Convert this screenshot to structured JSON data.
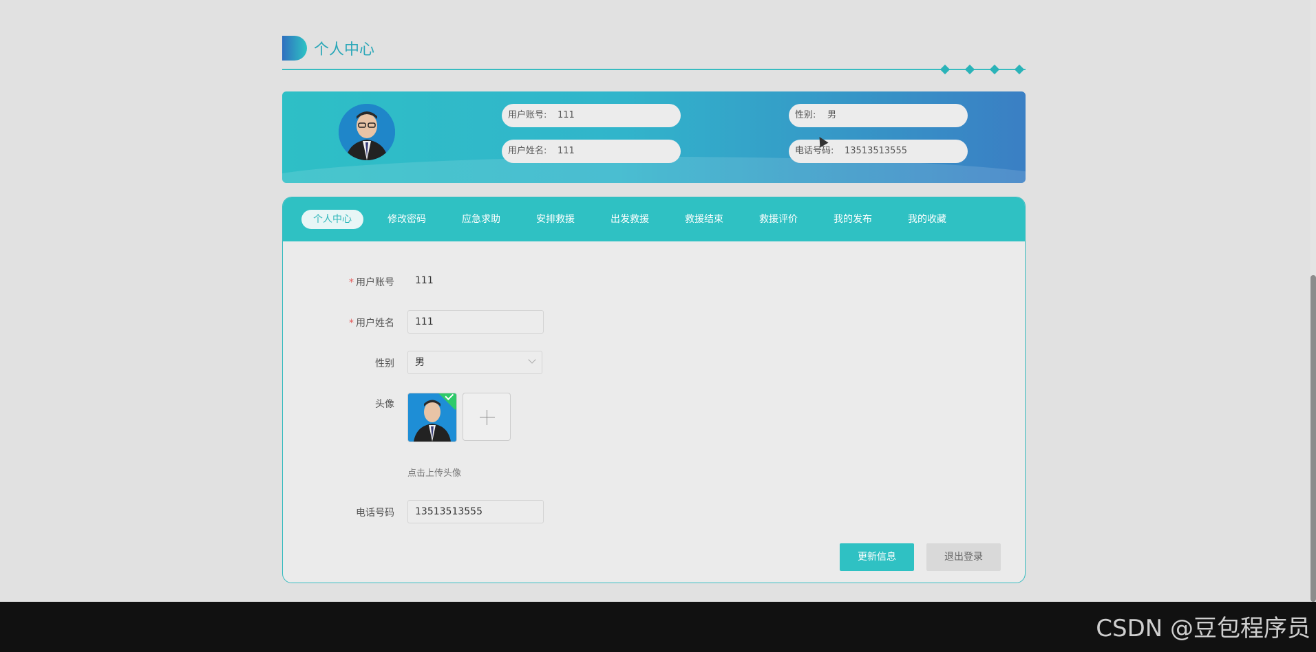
{
  "header": {
    "title": "个人中心"
  },
  "banner": {
    "account_label": "用户账号:",
    "account_value": "111",
    "name_label": "用户姓名:",
    "name_value": "111",
    "gender_label": "性别:",
    "gender_value": "男",
    "phone_label": "电话号码:",
    "phone_value": "13513513555"
  },
  "tabs": [
    {
      "label": "个人中心",
      "active": true
    },
    {
      "label": "修改密码"
    },
    {
      "label": "应急求助"
    },
    {
      "label": "安排救援"
    },
    {
      "label": "出发救援"
    },
    {
      "label": "救援结束"
    },
    {
      "label": "救援评价"
    },
    {
      "label": "我的发布"
    },
    {
      "label": "我的收藏"
    }
  ],
  "form": {
    "account_label": "用户账号",
    "account_value": "111",
    "name_label": "用户姓名",
    "name_value": "111",
    "gender_label": "性别",
    "gender_value": "男",
    "avatar_label": "头像",
    "upload_hint": "点击上传头像",
    "phone_label": "电话号码",
    "phone_value": "13513513555",
    "required_mark": "*"
  },
  "buttons": {
    "update": "更新信息",
    "logout": "退出登录"
  },
  "watermark": "CSDN @豆包程序员",
  "colors": {
    "accent": "#2fc1c3",
    "required": "#e45b5b"
  },
  "icons": [
    "user-avatar-icon",
    "checkmark-icon",
    "plus-icon",
    "chevron-down-icon",
    "title-badge-icon",
    "diamond-icon"
  ]
}
